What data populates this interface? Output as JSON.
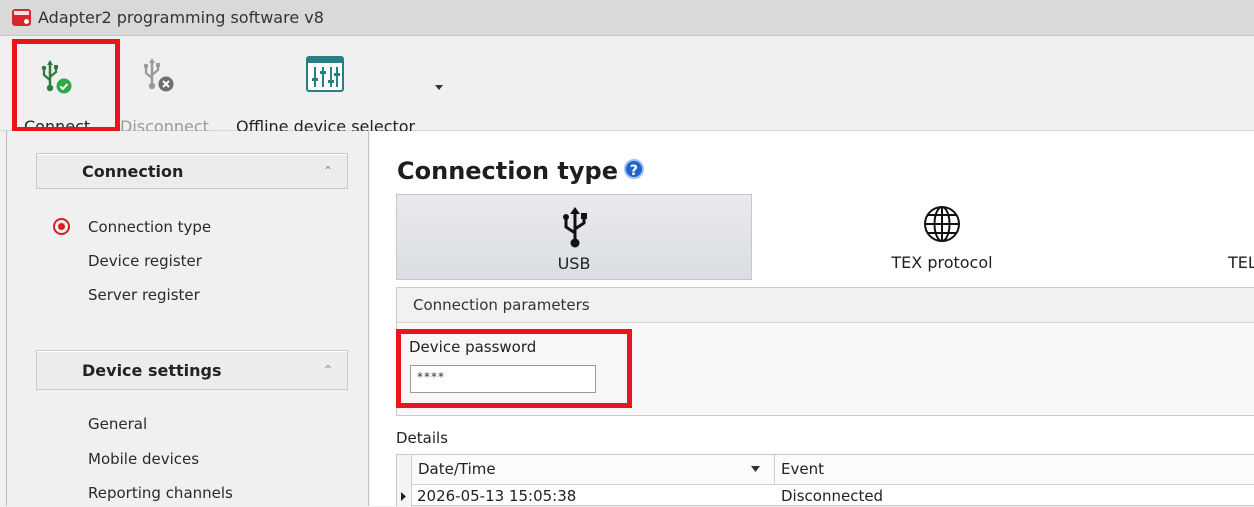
{
  "window": {
    "title": "Adapter2 programming software v8"
  },
  "toolbar": {
    "connect_label": "Connect",
    "disconnect_label": "Disconnect",
    "offline_selector_label": "Offline device selector"
  },
  "sidebar": {
    "groups": [
      {
        "title": "Connection",
        "items": [
          "Connection type",
          "Device register",
          "Server register"
        ]
      },
      {
        "title": "Device settings",
        "items": [
          "General",
          "Mobile devices",
          "Reporting channels"
        ]
      }
    ]
  },
  "main": {
    "title": "Connection type",
    "help_glyph": "?",
    "connection_types": [
      {
        "label": "USB",
        "selected": true
      },
      {
        "label": "TEX protocol",
        "selected": false
      },
      {
        "label": "TEL",
        "selected": false
      }
    ],
    "parameters_header": "Connection parameters",
    "password_label": "Device password",
    "password_value": "****",
    "details_label": "Details",
    "details_table": {
      "columns": [
        "Date/Time",
        "Event"
      ],
      "rows": [
        {
          "datetime": "2026-05-13 15:05:38",
          "event": "Disconnected"
        }
      ]
    }
  },
  "colors": {
    "highlight": "#e8161b",
    "selected_radio": "#d81e24",
    "help_icon": "#1e66c8",
    "connect_ok": "#2ea84a"
  }
}
